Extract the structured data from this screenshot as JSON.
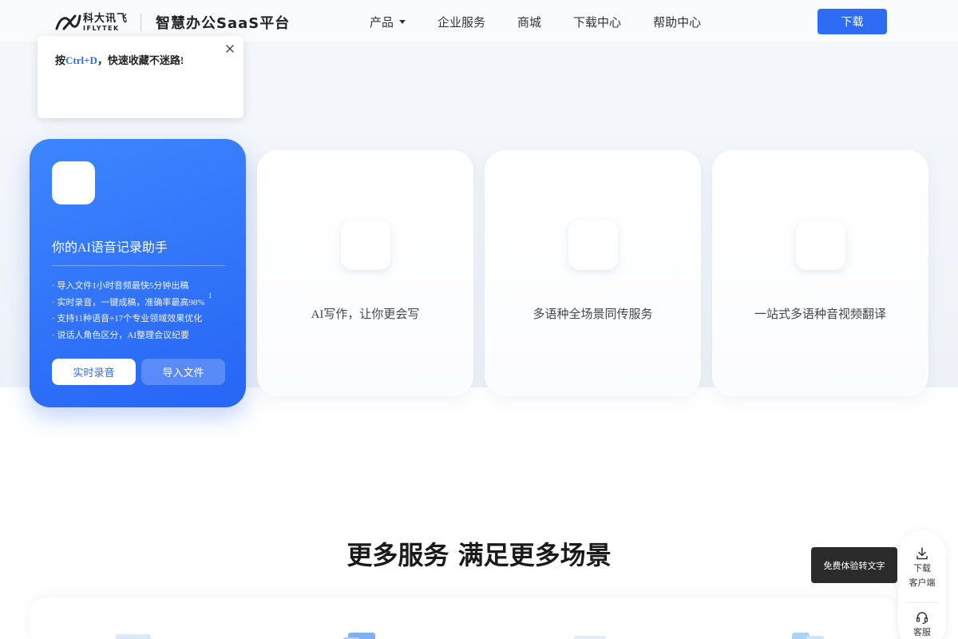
{
  "header": {
    "logo_cn": "科大讯飞",
    "logo_en": "IFLYTEK",
    "slogan": "智慧办公SaaS平台",
    "nav": [
      {
        "label": "产品",
        "has_dropdown": true
      },
      {
        "label": "企业服务"
      },
      {
        "label": "商城"
      },
      {
        "label": "下载中心"
      },
      {
        "label": "帮助中心"
      }
    ],
    "download_label": "下载"
  },
  "bookmark_tip": {
    "prefix": "按",
    "shortcut": "Ctrl+D",
    "suffix": "，快速收藏不迷路!"
  },
  "main_card": {
    "title": "你的AI语音记录助手",
    "features": [
      "· 导入文件1小时音频最快5分钟出稿",
      "· 实时录音，一键成稿，准确率最高98%",
      "· 支持11种语音+17个专业领域效果优化",
      "· 说话人角色区分，AI整理会议纪要"
    ],
    "footnote": "1",
    "record_label": "实时录音",
    "import_label": "导入文件"
  },
  "cards": [
    {
      "title": "AI写作，让你更会写"
    },
    {
      "title": "多语种全场景同传服务"
    },
    {
      "title": "一站式多语种音视频翻译"
    }
  ],
  "section": {
    "title": "更多服务 满足更多场景"
  },
  "float": {
    "tip": "免费体验转文字",
    "download_line1": "下载",
    "download_line2": "客户端",
    "service": "客服"
  },
  "colors": {
    "brand_blue": "#2f6cf6",
    "dark_tip": "#2b2b2b"
  }
}
